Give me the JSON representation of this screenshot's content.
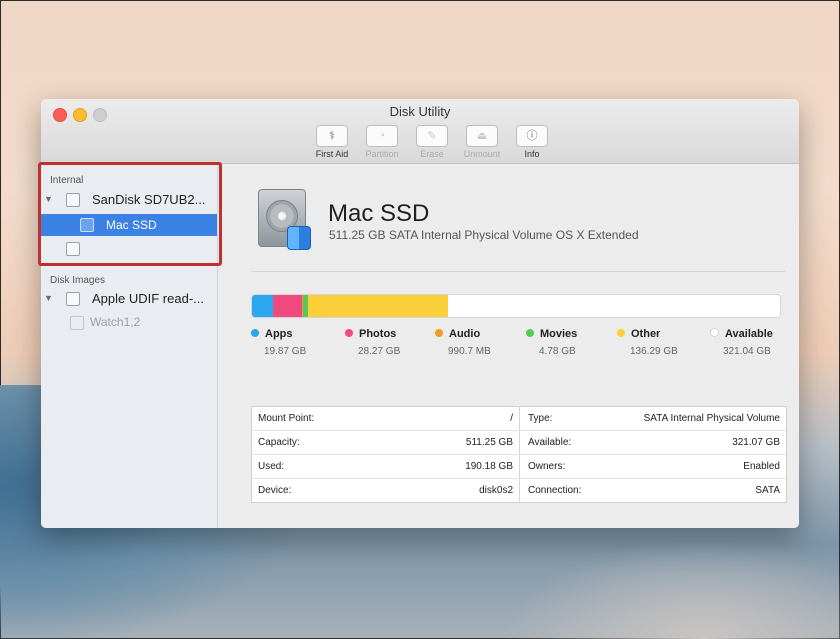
{
  "window": {
    "title": "Disk Utility"
  },
  "toolbar": {
    "first_aid": {
      "label": "First Aid",
      "icon": "stethoscope-icon"
    },
    "partition": {
      "label": "Partition",
      "icon": "partition-icon"
    },
    "erase": {
      "label": "Erase",
      "icon": "erase-icon"
    },
    "unmount": {
      "label": "Unmount",
      "icon": "eject-icon"
    },
    "info": {
      "label": "Info",
      "icon": "info-icon"
    }
  },
  "sidebar": {
    "internal_header": "Internal",
    "internal_items": [
      {
        "label": "SanDisk SD7UB2..."
      },
      {
        "label": "Mac SSD",
        "selected": true
      },
      {
        "label": ""
      }
    ],
    "images_header": "Disk Images",
    "image_items": [
      {
        "label": "Apple UDIF read-..."
      },
      {
        "label": "Watch1,2"
      }
    ]
  },
  "volume": {
    "name": "Mac SSD",
    "description": "511.25 GB SATA Internal Physical Volume OS X Extended"
  },
  "usage": {
    "segments": [
      {
        "name": "Apps",
        "size": "19.87 GB",
        "color": "#2aa7ef",
        "fraction": 0.0389
      },
      {
        "name": "Photos",
        "size": "28.27 GB",
        "color": "#ef4a7d",
        "fraction": 0.0553
      },
      {
        "name": "Audio",
        "size": "990.7 MB",
        "color": "#f39a2a",
        "fraction": 0.0019
      },
      {
        "name": "Movies",
        "size": "4.78 GB",
        "color": "#57c95a",
        "fraction": 0.0094
      },
      {
        "name": "Other",
        "size": "136.29 GB",
        "color": "#fbd03b",
        "fraction": 0.2666
      },
      {
        "name": "Available",
        "size": "321.04 GB",
        "color": "#ffffff",
        "fraction": 0.6279
      }
    ]
  },
  "info": {
    "rows": [
      {
        "k1": "Mount Point:",
        "v1": "/",
        "k2": "Type:",
        "v2": "SATA Internal Physical Volume"
      },
      {
        "k1": "Capacity:",
        "v1": "511.25 GB",
        "k2": "Available:",
        "v2": "321.07 GB"
      },
      {
        "k1": "Used:",
        "v1": "190.18 GB",
        "k2": "Owners:",
        "v2": "Enabled"
      },
      {
        "k1": "Device:",
        "v1": "disk0s2",
        "k2": "Connection:",
        "v2": "SATA"
      }
    ]
  }
}
